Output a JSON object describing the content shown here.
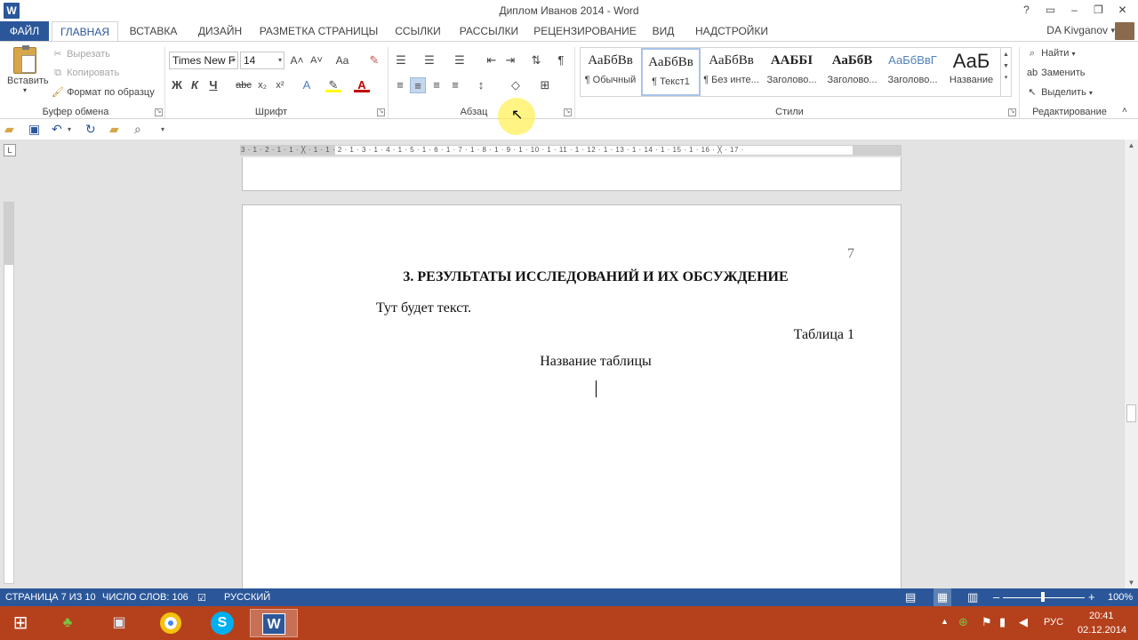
{
  "window": {
    "title": "Диплом Иванов 2014 - Word",
    "controls": [
      "?",
      "▭",
      "–",
      "❐",
      "✕"
    ]
  },
  "tabs": {
    "file": "ФАЙЛ",
    "home": "ГЛАВНАЯ",
    "insert": "ВСТАВКА",
    "design": "ДИЗАЙН",
    "layout": "РАЗМЕТКА СТРАНИЦЫ",
    "references": "ССЫЛКИ",
    "mailings": "РАССЫЛКИ",
    "review": "РЕЦЕНЗИРОВАНИЕ",
    "view": "ВИД",
    "addins": "НАДСТРОЙКИ"
  },
  "user": {
    "name": "DA Kivganov"
  },
  "clipboard": {
    "paste": "Вставить",
    "cut": "Вырезать",
    "copy": "Копировать",
    "format_painter": "Формат по образцу",
    "label": "Буфер обмена"
  },
  "font": {
    "name": "Times New F",
    "size": "14",
    "label": "Шрифт",
    "bold": "Ж",
    "italic": "К",
    "underline": "Ч",
    "strike": "abc",
    "subscript": "x₂",
    "superscript": "x²",
    "grow": "A˄",
    "shrink": "A˅",
    "case": "Aa"
  },
  "paragraph": {
    "label": "Абзац"
  },
  "styles": {
    "label": "Стили",
    "items": [
      {
        "preview": "АаБбВв",
        "name": "¶ Обычный"
      },
      {
        "preview": "АаБбВв",
        "name": "¶ Текст1"
      },
      {
        "preview": "АаБбВв",
        "name": "¶ Без инте..."
      },
      {
        "preview": "ААББІ",
        "name": "Заголово..."
      },
      {
        "preview": "АаБбВ",
        "name": "Заголово..."
      },
      {
        "preview": "АаБбВвГ",
        "name": "Заголово..."
      },
      {
        "preview": "АаБ",
        "name": "Название"
      }
    ]
  },
  "editing": {
    "label": "Редактирование",
    "find": "Найти",
    "replace": "Заменить",
    "select": "Выделить"
  },
  "ruler": {
    "marks": "3 · 1 · 2 · 1 · 1 · ╳ · 1 · 1 · 2 · 1 · 3 · 1 · 4 · 1 · 5 · 1 · 6 · 1 · 7 · 1 · 8 · 1 · 9 · 1 · 10 · 1 · 11 · 1 · 12 · 1 · 13 · 1 · 14 · 1 · 15 · 1 · 16 · ╳ · 17 ·"
  },
  "document": {
    "page_number": "7",
    "heading": "3. РЕЗУЛЬТАТЫ ИССЛЕДОВАНИЙ И ИХ ОБСУЖДЕНИЕ",
    "paragraph": "Тут будет текст.",
    "table_label": "Таблица 1",
    "table_title": "Название таблицы"
  },
  "status": {
    "page": "СТРАНИЦА 7 ИЗ 10",
    "words": "ЧИСЛО СЛОВ: 106",
    "language": "РУССКИЙ",
    "zoom": "100%"
  },
  "taskbar": {
    "language": "РУС",
    "time": "20:41",
    "date": "02.12.2014"
  },
  "colors": {
    "accent": "#2b579a",
    "taskbar": "#b5411c",
    "pointer_halo": "#fff050"
  }
}
